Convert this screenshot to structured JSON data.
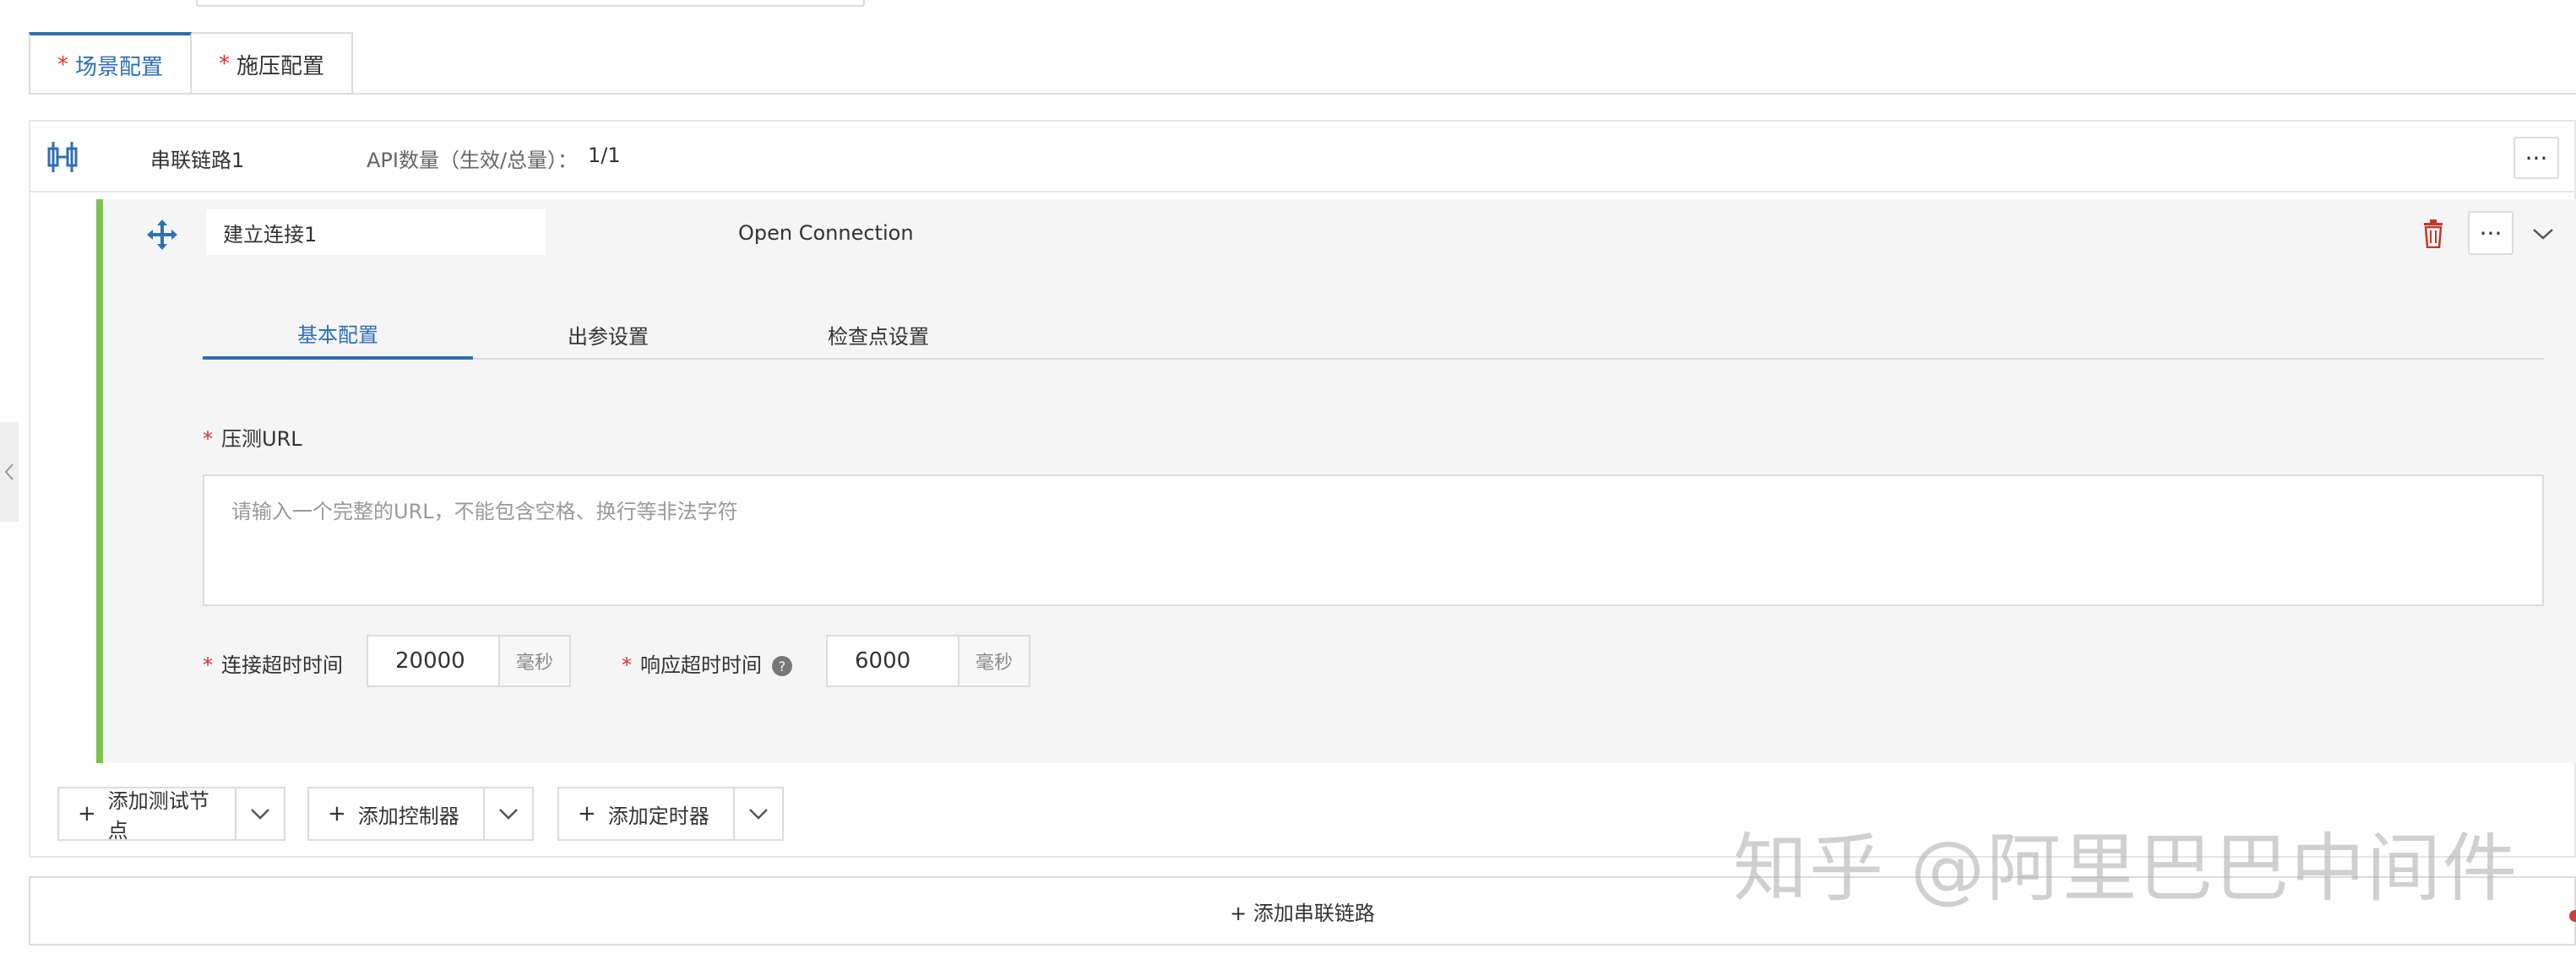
{
  "tabs": [
    {
      "label": "场景配置",
      "required": "*"
    },
    {
      "label": "施压配置",
      "required": "*"
    }
  ],
  "chain": {
    "title": "串联链路1",
    "api_label": "API数量（生效/总量）：",
    "api_value": "1/1",
    "more_label": "···"
  },
  "node": {
    "name": "建立连接1",
    "type": "Open Connection",
    "more_label": "···",
    "subtabs": [
      "基本配置",
      "出参设置",
      "检查点设置"
    ],
    "url": {
      "label": "压测URL",
      "required": "*",
      "placeholder": "请输入一个完整的URL，不能包含空格、换行等非法字符"
    },
    "connect_timeout": {
      "label": "连接超时时间",
      "required": "*",
      "value": "20000",
      "unit": "毫秒"
    },
    "response_timeout": {
      "label": "响应超时时间",
      "required": "*",
      "value": "6000",
      "unit": "毫秒",
      "help": "?"
    }
  },
  "add_buttons": [
    {
      "plus": "+",
      "label": "添加测试节点"
    },
    {
      "plus": "+",
      "label": "添加控制器"
    },
    {
      "plus": "+",
      "label": "添加定时器"
    }
  ],
  "add_chain_label": "+ 添加串联链路",
  "watermark": "知乎 @阿里巴巴中间件",
  "colors": {
    "accent": "#2f6fb5",
    "required": "#d9342b",
    "node_bar": "#7ec250",
    "delete": "#c0392b"
  }
}
